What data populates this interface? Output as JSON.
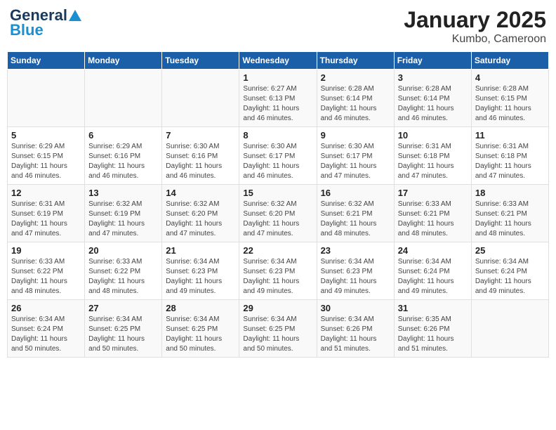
{
  "header": {
    "logo_general": "General",
    "logo_blue": "Blue",
    "title": "January 2025",
    "subtitle": "Kumbo, Cameroon"
  },
  "weekdays": [
    "Sunday",
    "Monday",
    "Tuesday",
    "Wednesday",
    "Thursday",
    "Friday",
    "Saturday"
  ],
  "weeks": [
    [
      {
        "day": "",
        "info": ""
      },
      {
        "day": "",
        "info": ""
      },
      {
        "day": "",
        "info": ""
      },
      {
        "day": "1",
        "info": "Sunrise: 6:27 AM\nSunset: 6:13 PM\nDaylight: 11 hours\nand 46 minutes."
      },
      {
        "day": "2",
        "info": "Sunrise: 6:28 AM\nSunset: 6:14 PM\nDaylight: 11 hours\nand 46 minutes."
      },
      {
        "day": "3",
        "info": "Sunrise: 6:28 AM\nSunset: 6:14 PM\nDaylight: 11 hours\nand 46 minutes."
      },
      {
        "day": "4",
        "info": "Sunrise: 6:28 AM\nSunset: 6:15 PM\nDaylight: 11 hours\nand 46 minutes."
      }
    ],
    [
      {
        "day": "5",
        "info": "Sunrise: 6:29 AM\nSunset: 6:15 PM\nDaylight: 11 hours\nand 46 minutes."
      },
      {
        "day": "6",
        "info": "Sunrise: 6:29 AM\nSunset: 6:16 PM\nDaylight: 11 hours\nand 46 minutes."
      },
      {
        "day": "7",
        "info": "Sunrise: 6:30 AM\nSunset: 6:16 PM\nDaylight: 11 hours\nand 46 minutes."
      },
      {
        "day": "8",
        "info": "Sunrise: 6:30 AM\nSunset: 6:17 PM\nDaylight: 11 hours\nand 46 minutes."
      },
      {
        "day": "9",
        "info": "Sunrise: 6:30 AM\nSunset: 6:17 PM\nDaylight: 11 hours\nand 47 minutes."
      },
      {
        "day": "10",
        "info": "Sunrise: 6:31 AM\nSunset: 6:18 PM\nDaylight: 11 hours\nand 47 minutes."
      },
      {
        "day": "11",
        "info": "Sunrise: 6:31 AM\nSunset: 6:18 PM\nDaylight: 11 hours\nand 47 minutes."
      }
    ],
    [
      {
        "day": "12",
        "info": "Sunrise: 6:31 AM\nSunset: 6:19 PM\nDaylight: 11 hours\nand 47 minutes."
      },
      {
        "day": "13",
        "info": "Sunrise: 6:32 AM\nSunset: 6:19 PM\nDaylight: 11 hours\nand 47 minutes."
      },
      {
        "day": "14",
        "info": "Sunrise: 6:32 AM\nSunset: 6:20 PM\nDaylight: 11 hours\nand 47 minutes."
      },
      {
        "day": "15",
        "info": "Sunrise: 6:32 AM\nSunset: 6:20 PM\nDaylight: 11 hours\nand 47 minutes."
      },
      {
        "day": "16",
        "info": "Sunrise: 6:32 AM\nSunset: 6:21 PM\nDaylight: 11 hours\nand 48 minutes."
      },
      {
        "day": "17",
        "info": "Sunrise: 6:33 AM\nSunset: 6:21 PM\nDaylight: 11 hours\nand 48 minutes."
      },
      {
        "day": "18",
        "info": "Sunrise: 6:33 AM\nSunset: 6:21 PM\nDaylight: 11 hours\nand 48 minutes."
      }
    ],
    [
      {
        "day": "19",
        "info": "Sunrise: 6:33 AM\nSunset: 6:22 PM\nDaylight: 11 hours\nand 48 minutes."
      },
      {
        "day": "20",
        "info": "Sunrise: 6:33 AM\nSunset: 6:22 PM\nDaylight: 11 hours\nand 48 minutes."
      },
      {
        "day": "21",
        "info": "Sunrise: 6:34 AM\nSunset: 6:23 PM\nDaylight: 11 hours\nand 49 minutes."
      },
      {
        "day": "22",
        "info": "Sunrise: 6:34 AM\nSunset: 6:23 PM\nDaylight: 11 hours\nand 49 minutes."
      },
      {
        "day": "23",
        "info": "Sunrise: 6:34 AM\nSunset: 6:23 PM\nDaylight: 11 hours\nand 49 minutes."
      },
      {
        "day": "24",
        "info": "Sunrise: 6:34 AM\nSunset: 6:24 PM\nDaylight: 11 hours\nand 49 minutes."
      },
      {
        "day": "25",
        "info": "Sunrise: 6:34 AM\nSunset: 6:24 PM\nDaylight: 11 hours\nand 49 minutes."
      }
    ],
    [
      {
        "day": "26",
        "info": "Sunrise: 6:34 AM\nSunset: 6:24 PM\nDaylight: 11 hours\nand 50 minutes."
      },
      {
        "day": "27",
        "info": "Sunrise: 6:34 AM\nSunset: 6:25 PM\nDaylight: 11 hours\nand 50 minutes."
      },
      {
        "day": "28",
        "info": "Sunrise: 6:34 AM\nSunset: 6:25 PM\nDaylight: 11 hours\nand 50 minutes."
      },
      {
        "day": "29",
        "info": "Sunrise: 6:34 AM\nSunset: 6:25 PM\nDaylight: 11 hours\nand 50 minutes."
      },
      {
        "day": "30",
        "info": "Sunrise: 6:34 AM\nSunset: 6:26 PM\nDaylight: 11 hours\nand 51 minutes."
      },
      {
        "day": "31",
        "info": "Sunrise: 6:35 AM\nSunset: 6:26 PM\nDaylight: 11 hours\nand 51 minutes."
      },
      {
        "day": "",
        "info": ""
      }
    ]
  ]
}
